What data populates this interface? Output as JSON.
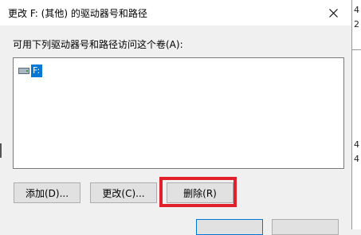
{
  "window": {
    "title": "更改 F: (其他) 的驱动器号和路径",
    "close_icon": "close-icon"
  },
  "prompt": "可用下列驱动器号和路径访问这个卷(A):",
  "list": {
    "items": [
      {
        "label": "F:",
        "icon": "drive-icon",
        "selected": true
      }
    ]
  },
  "buttons": {
    "add": "添加(D)...",
    "change": "更改(C)...",
    "remove": "删除(R)"
  },
  "highlight_color": "#e0202a",
  "selection_color": "#0078d7",
  "background_window": {
    "digits": [
      "4",
      "2",
      "4",
      "4"
    ]
  }
}
